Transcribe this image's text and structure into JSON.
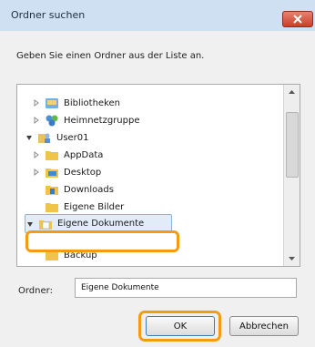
{
  "dialog": {
    "title": "Ordner suchen",
    "instruction": "Geben Sie einen Ordner aus der Liste an.",
    "tree": [
      {
        "label": "Bibliotheken",
        "icon": "library-icon",
        "expander": "collapsed"
      },
      {
        "label": "Heimnetzgruppe",
        "icon": "homegroup-icon",
        "expander": "collapsed"
      },
      {
        "label": "User01",
        "icon": "user-folder-icon",
        "expander": "expanded"
      },
      {
        "label": "AppData",
        "icon": "folder-icon",
        "expander": "collapsed"
      },
      {
        "label": "Desktop",
        "icon": "desktop-folder-icon",
        "expander": "collapsed"
      },
      {
        "label": "Downloads",
        "icon": "downloads-folder-icon",
        "expander": "none"
      },
      {
        "label": "Eigene Bilder",
        "icon": "pictures-folder-icon",
        "expander": "none"
      },
      {
        "label": "Eigene Dokumente",
        "icon": "documents-folder-icon",
        "expander": "expanded",
        "selected": true
      },
      {
        "label": "Backup",
        "icon": "folder-icon",
        "expander": "none"
      }
    ],
    "folder_label": "Ordner:",
    "folder_value": "Eigene Dokumente",
    "ok_label": "OK",
    "cancel_label": "Abbrechen",
    "colors": {
      "title_bar": "#cfe0f3",
      "close_button": "#c8402a",
      "highlight": "#f39c12",
      "selection": "#e2ecf8"
    }
  }
}
